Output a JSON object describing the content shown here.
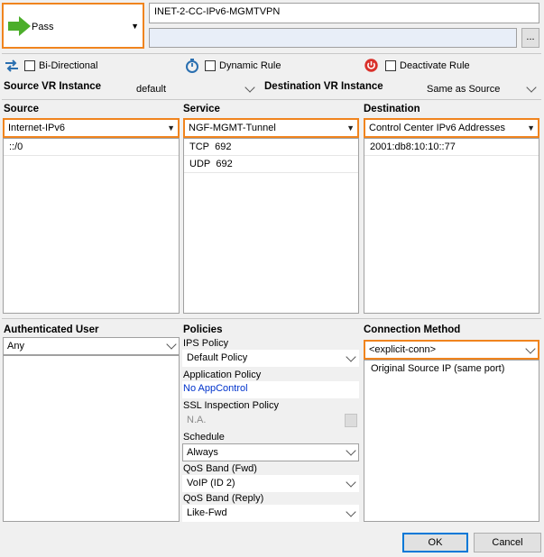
{
  "action": {
    "label": "Pass"
  },
  "rule_name": "INET-2-CC-IPv6-MGMTVPN",
  "description": "",
  "description_button": "...",
  "options": {
    "bidirectional": "Bi-Directional",
    "dynamic_rule": "Dynamic Rule",
    "deactivate_rule": "Deactivate Rule"
  },
  "vr": {
    "source_label": "Source VR Instance",
    "source_value": "default",
    "dest_label": "Destination VR Instance",
    "dest_value": "Same as Source"
  },
  "source": {
    "label": "Source",
    "selected": "Internet-IPv6",
    "items": [
      "::/0"
    ]
  },
  "service": {
    "label": "Service",
    "selected": "NGF-MGMT-Tunnel",
    "items": [
      {
        "proto": "TCP",
        "port": "692"
      },
      {
        "proto": "UDP",
        "port": "692"
      }
    ]
  },
  "destination": {
    "label": "Destination",
    "selected": "Control Center IPv6 Addresses",
    "items": [
      "2001:db8:10:10::77"
    ]
  },
  "auth_user": {
    "label": "Authenticated User",
    "selected": "Any"
  },
  "policies": {
    "label": "Policies",
    "ips_label": "IPS Policy",
    "ips_value": "Default Policy",
    "app_label": "Application Policy",
    "app_value": "No AppControl",
    "ssl_label": "SSL Inspection Policy",
    "ssl_value": "N.A.",
    "schedule_label": "Schedule",
    "schedule_value": "Always",
    "qos_fwd_label": "QoS Band (Fwd)",
    "qos_fwd_value": "VoIP (ID 2)",
    "qos_reply_label": "QoS Band (Reply)",
    "qos_reply_value": "Like-Fwd"
  },
  "connection": {
    "label": "Connection Method",
    "selected": "<explicit-conn>",
    "items": [
      "Original Source IP (same port)"
    ]
  },
  "buttons": {
    "ok": "OK",
    "cancel": "Cancel"
  },
  "colors": {
    "highlight": "#f0841e",
    "pass_arrow": "#4cae2b",
    "link": "#0033cc",
    "deactivate": "#d9302a"
  }
}
